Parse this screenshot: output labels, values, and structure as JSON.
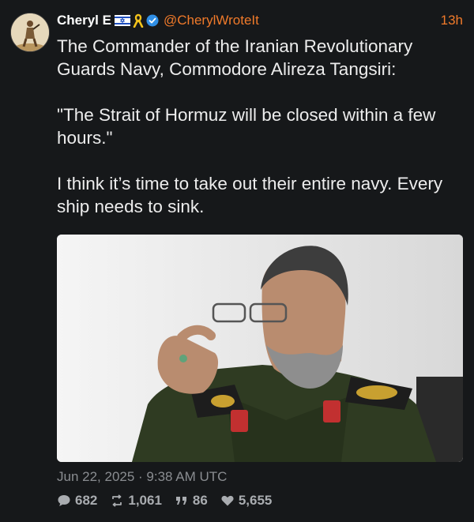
{
  "author": {
    "name": "Cheryl E",
    "handle": "@CherylWroteIt",
    "time": "13h",
    "badges": [
      "israel-flag-icon",
      "yellow-ribbon-icon",
      "verified-badge-icon"
    ]
  },
  "post": {
    "paragraphs": [
      "The Commander of the Iranian Revolutionary Guards Navy, Commodore Alireza Tangsiri:",
      "\"The Strait of Hormuz will be closed within a few hours.\"",
      "I think it’s time to take out their entire navy. Every ship needs to sink."
    ],
    "timestamp": "Jun 22, 2025 · 9:38 AM UTC"
  },
  "stats": {
    "replies": "682",
    "reposts": "1,061",
    "quotes": "86",
    "likes": "5,655"
  },
  "colors": {
    "background": "#16181a",
    "accent": "#f07a2a",
    "muted": "#8a8d91"
  }
}
